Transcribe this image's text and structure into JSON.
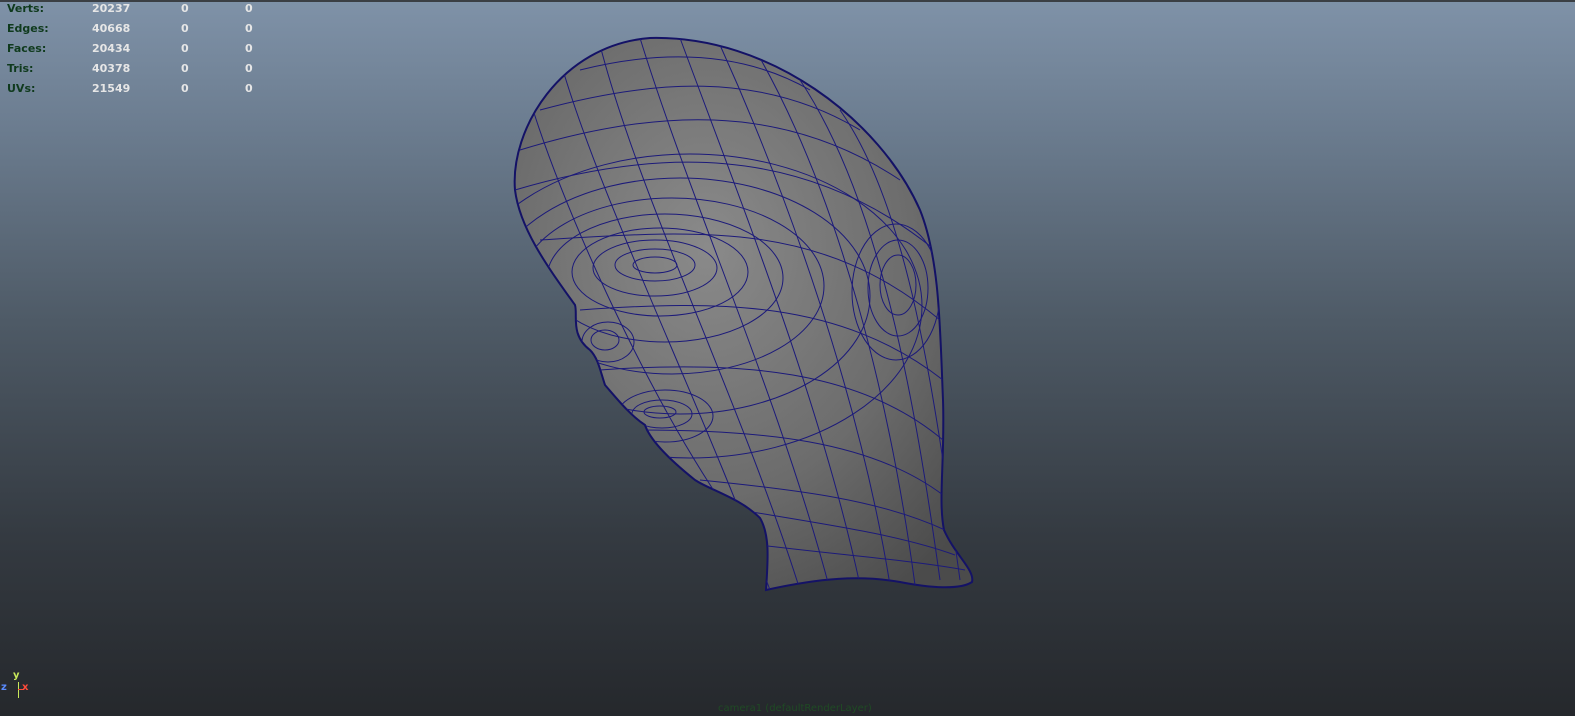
{
  "hud": {
    "rows": [
      {
        "label": "Verts:",
        "c1": "20237",
        "c2": "0",
        "c3": "0"
      },
      {
        "label": "Edges:",
        "c1": "40668",
        "c2": "0",
        "c3": "0"
      },
      {
        "label": "Faces:",
        "c1": "20434",
        "c2": "0",
        "c3": "0"
      },
      {
        "label": "Tris:",
        "c1": "40378",
        "c2": "0",
        "c3": "0"
      },
      {
        "label": "UVs:",
        "c1": "21549",
        "c2": "0",
        "c3": "0"
      }
    ]
  },
  "axis": {
    "y": "y",
    "x": "x",
    "z": "z"
  },
  "camera": {
    "label": "camera1 (defaultRenderLayer)"
  },
  "colors": {
    "wire": "#1c1a7a",
    "mesh": "#717171",
    "hud_label": "#0f3a1d",
    "hud_value": "#e6e6e6"
  }
}
